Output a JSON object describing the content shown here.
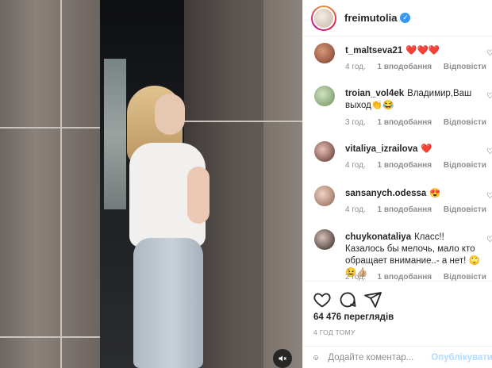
{
  "header": {
    "username": "freimutolia"
  },
  "comments": [
    {
      "user": "t_maltseva21",
      "text": "❤️❤️❤️",
      "time": "4 год.",
      "likes": "1 вподобання",
      "reply": "Відповісти"
    },
    {
      "user": "troian_vol4ek",
      "text": "Владимир,Ваш выход👏😂",
      "time": "3 год.",
      "likes": "1 вподобання",
      "reply": "Відповісти"
    },
    {
      "user": "vitaliya_izrailova",
      "text": "❤️",
      "time": "4 год.",
      "likes": "1 вподобання",
      "reply": "Відповісти"
    },
    {
      "user": "sansanych.odessa",
      "text": "😍",
      "time": "4 год.",
      "likes": "1 вподобання",
      "reply": "Відповісти"
    },
    {
      "user": "chuykonataliya",
      "text": "Класс!! Казалось бы мелочь, мало кто обращает внимание..- а нет! 🙄😉👍🏼",
      "time": "2 год.",
      "likes": "1 вподобання",
      "reply": "Відповісти"
    }
  ],
  "post": {
    "views": "64 476 переглядів",
    "time_ago": "4 ГОД ТОМУ"
  },
  "add_comment": {
    "placeholder": "Додайте коментар...",
    "post_label": "Опублікувати"
  },
  "colors": {
    "accent": "#3897f0",
    "post_disabled": "#b3dbff",
    "meta": "#8e8e8e"
  },
  "icons": {
    "verified": "verified-badge-icon",
    "heart": "heart-icon",
    "comment": "comment-icon",
    "share": "share-icon",
    "emoji": "emoji-icon",
    "mute": "mute-icon"
  }
}
